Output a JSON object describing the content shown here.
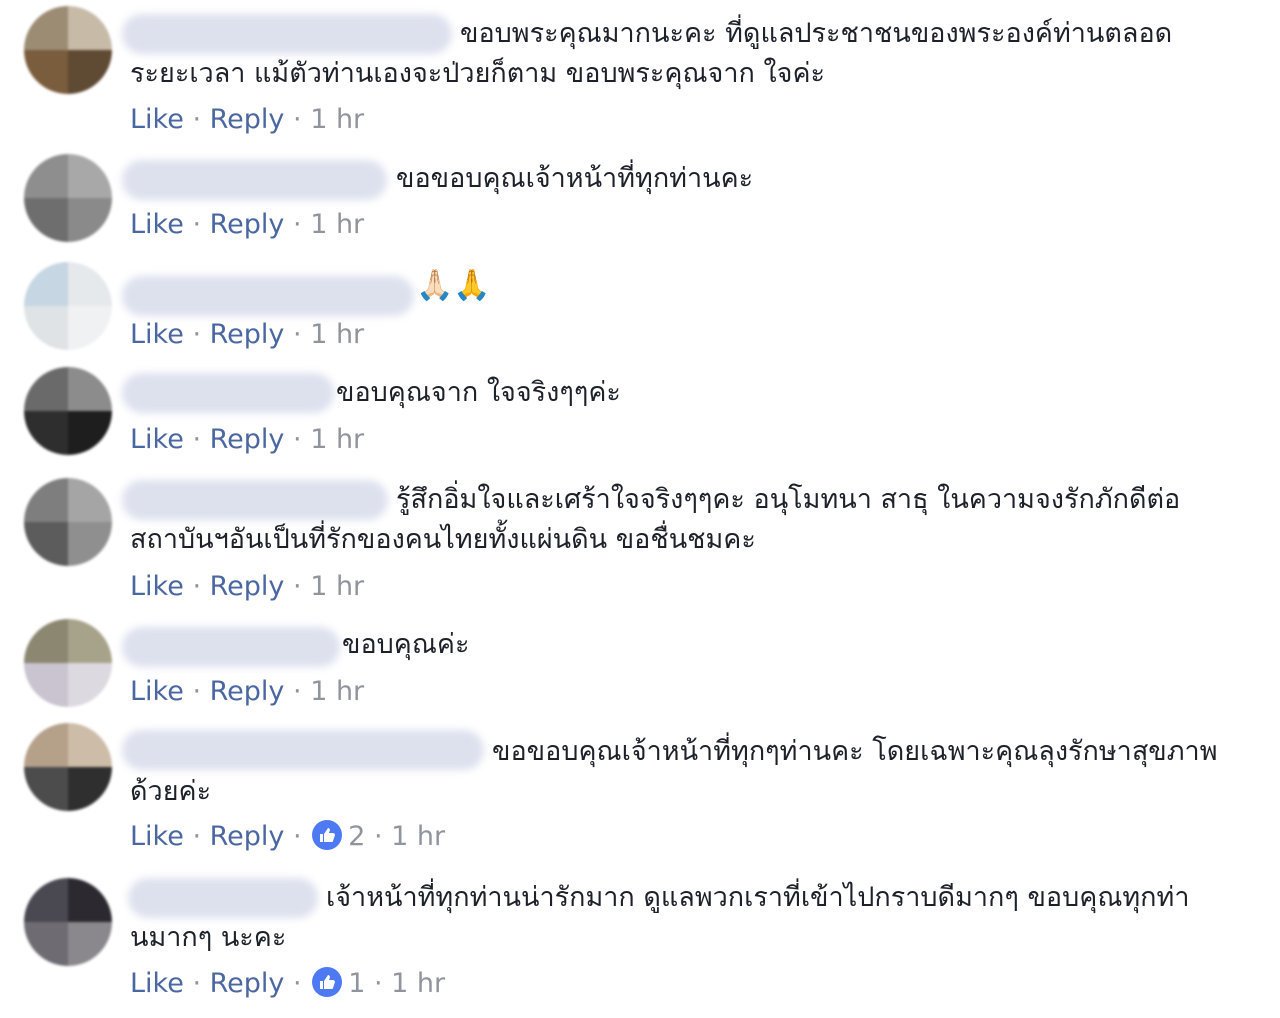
{
  "actions": {
    "like_label": "Like",
    "reply_label": "Reply",
    "dot": "·"
  },
  "comments": [
    {
      "text": "ขอบพระคุณมากนะคะ ที่ดูแลประชาชนของพระองค์ท่านตลอดระยะเวลา แม้ตัวท่านเองจะป่วยก็ตาม ขอบพระคุณจาก ใจค่ะ",
      "time": "1 hr",
      "reactions": ""
    },
    {
      "text": "ขอขอบคุณเจ้าหน้าที่ทุกท่านคะ",
      "time": "1 hr",
      "reactions": ""
    },
    {
      "text": "🙏🏻🙏",
      "time": "1 hr",
      "reactions": ""
    },
    {
      "text": "ขอบคุณจาก ใจจริงๆๆค่ะ",
      "time": "1 hr",
      "reactions": ""
    },
    {
      "text": "รู้สึกอิ่มใจและเศร้าใจจริงๆๆคะ อนุโมทนา สาธุ ในความจงรักภักดีต่อสถาบันฯอันเป็นที่รักของคนไทยทั้งแผ่นดิน ขอชื่นชมคะ",
      "time": "1 hr",
      "reactions": ""
    },
    {
      "text": "ขอบคุณค่ะ",
      "time": "1 hr",
      "reactions": ""
    },
    {
      "text": "ขอขอบคุณเจ้าหน้าที่ทุกๆท่านคะ โดยเฉพาะคุณลุงรักษาสุขภาพด้วยค่ะ",
      "time": "1 hr",
      "reactions": "2"
    },
    {
      "text": "เจ้าหน้าที่ทุกท่านน่ารักมาก ดูแลพวกเราที่เข้าไปกราบดีมากๆ ขอบคุณทุกท่านมากๆ นะคะ",
      "time": "1 hr",
      "reactions": "1"
    }
  ],
  "colors": {
    "link": "#4b67a1",
    "meta": "#90949c",
    "text": "#1d2129",
    "like_badge": "#4d7af3"
  },
  "icons": {
    "like_badge": "thumbs-up-icon"
  }
}
